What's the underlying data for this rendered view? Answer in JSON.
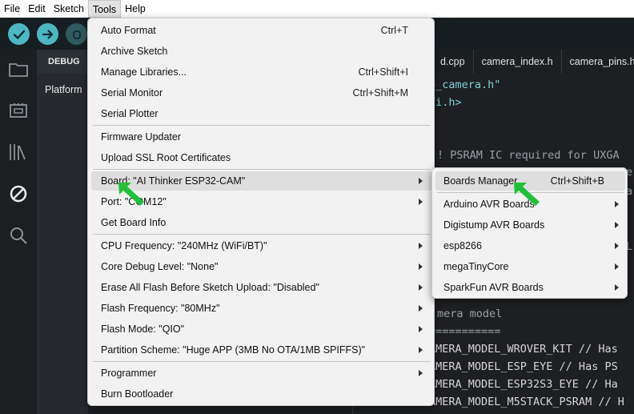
{
  "menubar": {
    "items": [
      "File",
      "Edit",
      "Sketch",
      "Tools",
      "Help"
    ],
    "active": "Tools"
  },
  "side_panel": {
    "header": "DEBUG",
    "platform_label": "Platform"
  },
  "editor": {
    "tabs": [
      "d.cpp",
      "camera_index.h",
      "camera_pins.h"
    ],
    "code_lines": [
      "p_camera.h\"",
      "Fi.h>",
      "! PSRAM IC required for UXGA",
      "mera model",
      "===========",
      "AMERA_MODEL_WROVER_KIT // Has",
      "AMERA_MODEL_ESP_EYE // Has PS",
      "AMERA_MODEL_ESP32S3_EYE // Ha",
      "AMERA_MODEL_M5STACK_PSRAM // H"
    ],
    "right_edge_chars": [
      "e",
      "a",
      "L"
    ]
  },
  "tools_menu": {
    "items": [
      {
        "label": "Auto Format",
        "shortcut": "Ctrl+T"
      },
      {
        "label": "Archive Sketch",
        "shortcut": ""
      },
      {
        "label": "Manage Libraries...",
        "shortcut": "Ctrl+Shift+I"
      },
      {
        "label": "Serial Monitor",
        "shortcut": "Ctrl+Shift+M"
      },
      {
        "label": "Serial Plotter",
        "shortcut": ""
      },
      {
        "label": "Firmware Updater",
        "shortcut": ""
      },
      {
        "label": "Upload SSL Root Certificates",
        "shortcut": ""
      },
      {
        "label": "Board: \"AI Thinker ESP32-CAM\"",
        "shortcut": ""
      },
      {
        "label": "Port: \"COM12\"",
        "shortcut": ""
      },
      {
        "label": "Get Board Info",
        "shortcut": ""
      },
      {
        "label": "CPU Frequency: \"240MHz (WiFi/BT)\"",
        "shortcut": ""
      },
      {
        "label": "Core Debug Level: \"None\"",
        "shortcut": ""
      },
      {
        "label": "Erase All Flash Before Sketch Upload: \"Disabled\"",
        "shortcut": ""
      },
      {
        "label": "Flash Frequency: \"80MHz\"",
        "shortcut": ""
      },
      {
        "label": "Flash Mode: \"QIO\"",
        "shortcut": ""
      },
      {
        "label": "Partition Scheme: \"Huge APP (3MB No OTA/1MB SPIFFS)\"",
        "shortcut": ""
      },
      {
        "label": "Programmer",
        "shortcut": ""
      },
      {
        "label": "Burn Bootloader",
        "shortcut": ""
      }
    ]
  },
  "board_submenu": {
    "items": [
      {
        "label": "Boards Manager...",
        "shortcut": "Ctrl+Shift+B"
      },
      {
        "label": "Arduino AVR Boards",
        "shortcut": ""
      },
      {
        "label": "Digistump AVR Boards",
        "shortcut": ""
      },
      {
        "label": "esp8266",
        "shortcut": ""
      },
      {
        "label": "megaTinyCore",
        "shortcut": ""
      },
      {
        "label": "SparkFun AVR Boards",
        "shortcut": ""
      }
    ]
  },
  "colors": {
    "accent": "#4db7c4",
    "pointer": "#22c03a",
    "menu_bg": "#f2f2f2",
    "editor_bg": "#1e1f22"
  }
}
